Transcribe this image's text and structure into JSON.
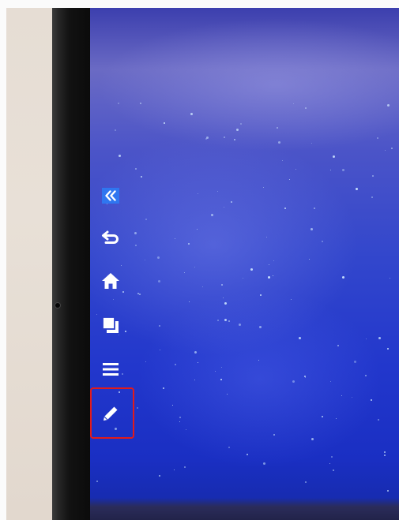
{
  "toolbar": {
    "items": [
      {
        "name": "collapse",
        "icon": "double-chevron-left-icon",
        "active": false
      },
      {
        "name": "back",
        "icon": "back-arrow-icon",
        "active": false
      },
      {
        "name": "home",
        "icon": "home-icon",
        "active": false
      },
      {
        "name": "windows",
        "icon": "multi-window-icon",
        "active": false
      },
      {
        "name": "menu",
        "icon": "list-menu-icon",
        "active": false
      },
      {
        "name": "annotate",
        "icon": "pen-icon",
        "active": true
      }
    ],
    "collapse_accent": "#2f76f0",
    "highlight_color": "#e21b1b"
  }
}
